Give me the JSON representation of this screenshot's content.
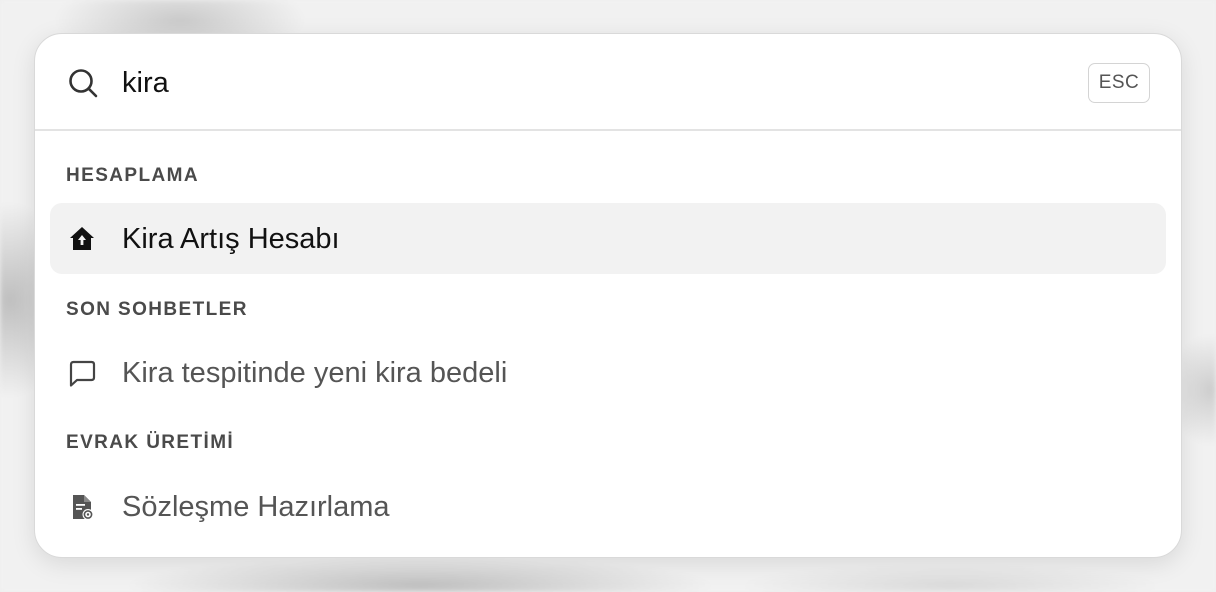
{
  "search": {
    "value": "kira",
    "esc_label": "ESC"
  },
  "sections": [
    {
      "title": "HESAPLAMA",
      "items": [
        {
          "label": "Kira Artış Hesabı",
          "icon": "home-icon",
          "active": true
        }
      ]
    },
    {
      "title": "SON SOHBETLER",
      "items": [
        {
          "label": "Kira tespitinde yeni kira bedeli",
          "icon": "chat-bubble-icon",
          "active": false
        }
      ]
    },
    {
      "title": "EVRAK ÜRETİMİ",
      "items": [
        {
          "label": "Sözleşme Hazırlama",
          "icon": "document-settings-icon",
          "active": false
        }
      ]
    }
  ]
}
